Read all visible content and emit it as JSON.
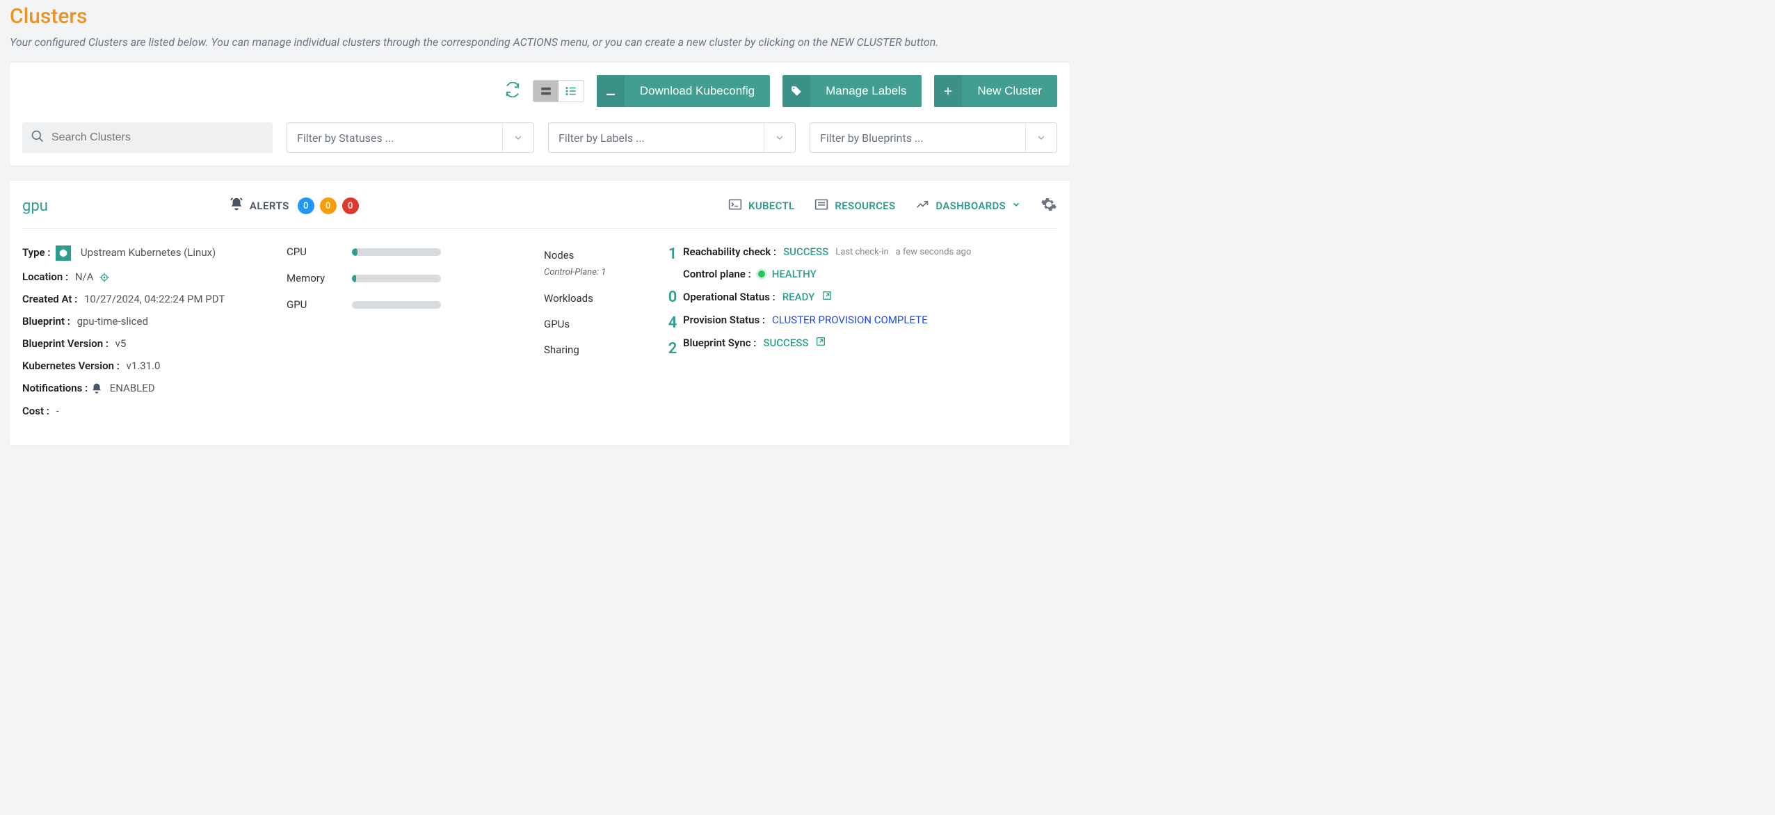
{
  "page": {
    "title": "Clusters",
    "subtitle": "Your configured Clusters are listed below. You can manage individual clusters through the corresponding ACTIONS menu, or you can create a new cluster by clicking on the NEW CLUSTER button."
  },
  "toolbar": {
    "download": "Download Kubeconfig",
    "labels": "Manage Labels",
    "new": "New Cluster",
    "search_placeholder": "Search Clusters",
    "filter_status": "Filter by Statuses ...",
    "filter_labels": "Filter by Labels ...",
    "filter_blueprints": "Filter by Blueprints ..."
  },
  "cluster": {
    "name": "gpu",
    "alerts_label": "ALERTS",
    "alerts": {
      "info": "0",
      "warn": "0",
      "err": "0"
    },
    "links": {
      "kubectl": "KUBECTL",
      "resources": "RESOURCES",
      "dashboards": "DASHBOARDS"
    },
    "meta": {
      "type_k": "Type :",
      "type_v": "Upstream Kubernetes (Linux)",
      "location_k": "Location :",
      "location_v": "N/A",
      "created_k": "Created At :",
      "created_v": "10/27/2024, 04:22:24 PM PDT",
      "blueprint_k": "Blueprint :",
      "blueprint_v": "gpu-time-sliced",
      "bpver_k": "Blueprint Version :",
      "bpver_v": "v5",
      "k8s_k": "Kubernetes Version :",
      "k8s_v": "v1.31.0",
      "notif_k": "Notifications :",
      "notif_v": "ENABLED",
      "cost_k": "Cost :",
      "cost_v": "-"
    },
    "bars": {
      "cpu": "CPU",
      "cpu_pct": 6,
      "mem": "Memory",
      "mem_pct": 5,
      "gpu": "GPU",
      "gpu_pct": 0
    },
    "stats": {
      "nodes_k": "Nodes",
      "nodes_v": "1",
      "cp_sub": "Control-Plane: 1",
      "workloads_k": "Workloads",
      "workloads_v": "0",
      "gpus_k": "GPUs",
      "gpus_v": "4",
      "sharing_k": "Sharing",
      "sharing_v": "2"
    },
    "status": {
      "reach_k": "Reachability check :",
      "reach_v": "SUCCESS",
      "reach_sub1": "Last check-in",
      "reach_sub2": "a few seconds ago",
      "cp_k": "Control plane :",
      "cp_v": "HEALTHY",
      "op_k": "Operational Status :",
      "op_v": "READY",
      "prov_k": "Provision Status :",
      "prov_v": "CLUSTER PROVISION COMPLETE",
      "sync_k": "Blueprint Sync :",
      "sync_v": "SUCCESS"
    }
  }
}
